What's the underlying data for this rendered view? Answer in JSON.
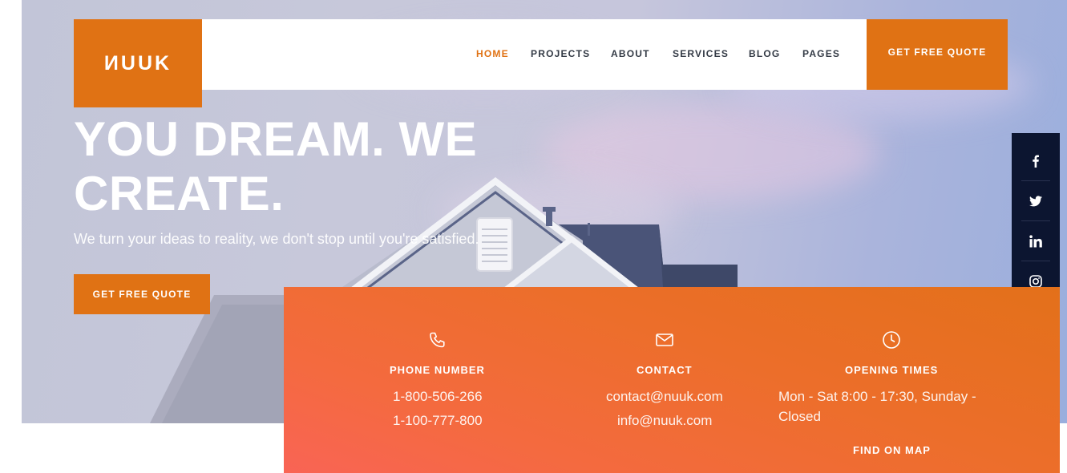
{
  "brand": {
    "logo_text": "ИUUK",
    "accent_color": "#e07214",
    "dark_color": "#0c1530"
  },
  "nav": {
    "items": [
      {
        "label": "HOME",
        "active": true
      },
      {
        "label": "PROJECTS",
        "active": false
      },
      {
        "label": "ABOUT",
        "active": false
      },
      {
        "label": "SERVICES",
        "active": false
      },
      {
        "label": "BLOG",
        "active": false
      },
      {
        "label": "PAGES",
        "active": false
      }
    ],
    "cta_label": "GET FREE QUOTE"
  },
  "hero": {
    "headline_line1": "YOU DREAM. WE",
    "headline_line2": "CREATE.",
    "subline": "We turn your ideas to reality, we don't stop until you're satisfied.",
    "cta_label": "GET FREE QUOTE"
  },
  "social": {
    "icons": [
      "facebook-icon",
      "twitter-icon",
      "linkedin-icon",
      "instagram-icon"
    ]
  },
  "info": {
    "phone": {
      "icon": "phone-icon",
      "title": "PHONE NUMBER",
      "lines": [
        "1-800-506-266",
        "1-100-777-800"
      ]
    },
    "contact": {
      "icon": "envelope-icon",
      "title": "CONTACT",
      "lines": [
        "contact@nuuk.com",
        "info@nuuk.com"
      ]
    },
    "hours": {
      "icon": "clock-icon",
      "title": "OPENING TIMES",
      "lines": [
        "Mon - Sat 8:00 - 17:30, Sunday -",
        "Closed"
      ],
      "link_label": "FIND ON MAP"
    }
  }
}
